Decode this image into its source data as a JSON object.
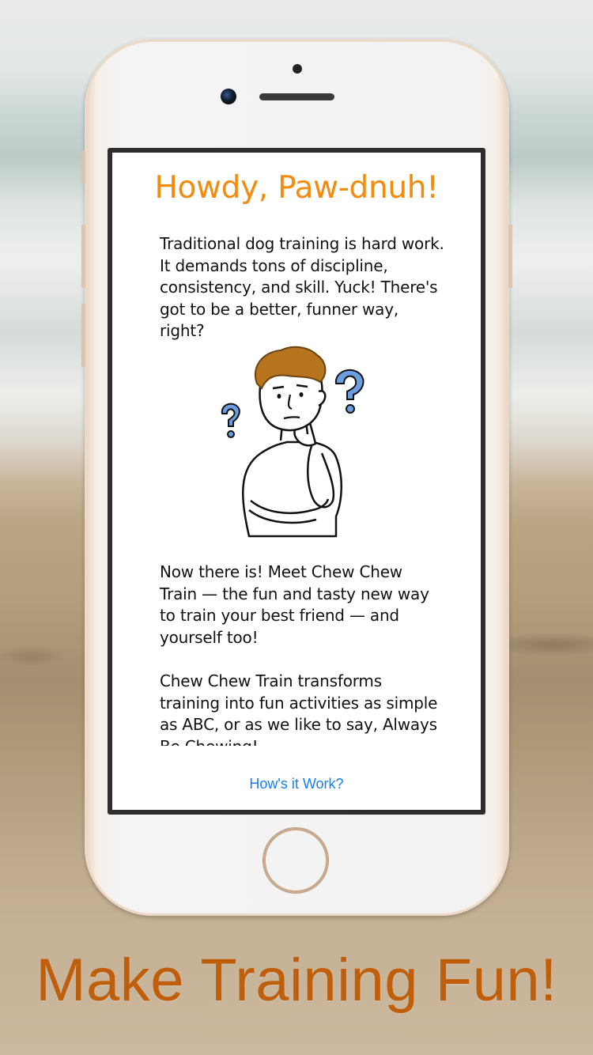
{
  "screen": {
    "title": "Howdy, Paw-dnuh!",
    "paragraph_1": "Traditional dog training is hard work. It demands tons of discipline, consistency, and skill. Yuck! There's got to be a better, funner way, right?",
    "paragraph_2": "Now there is! Meet Chew Chew Train — the fun and tasty new way to train your best friend — and yourself too!",
    "paragraph_3": "Chew Chew Train transforms training into fun activities as simple as ABC, or as we like to say, Always Be Chewing!",
    "link_label": "How's it Work?",
    "illustration_icon": "thinking-man-with-question-marks",
    "colors": {
      "title": "#f28c0f",
      "link": "#1a7fe5",
      "question_marks": "#6b9ee0",
      "hair": "#b7741f"
    }
  },
  "tagline": "Make Training Fun!",
  "tagline_color": "#c05f0b"
}
